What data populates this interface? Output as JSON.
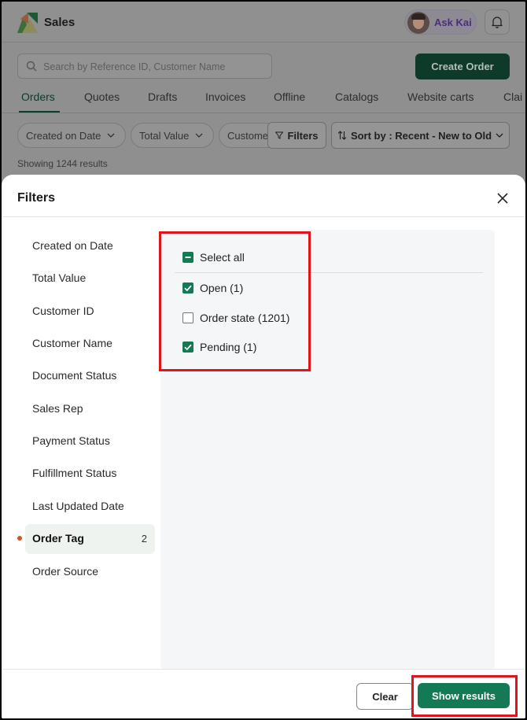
{
  "app": {
    "title": "Sales",
    "ask_label": "Ask Kai"
  },
  "search": {
    "placeholder": "Search by Reference ID, Customer Name"
  },
  "create_order_label": "Create Order",
  "tabs": [
    "Orders",
    "Quotes",
    "Drafts",
    "Invoices",
    "Offline",
    "Catalogs",
    "Website carts",
    "Clai"
  ],
  "chips": [
    "Created on Date",
    "Total Value",
    "Custome"
  ],
  "filters_label": "Filters",
  "sort_label": "Sort by : Recent - New to Old",
  "results_text": "Showing 1244 results",
  "sheet": {
    "title": "Filters",
    "nav": [
      {
        "label": "Created on Date"
      },
      {
        "label": "Total Value"
      },
      {
        "label": "Customer ID"
      },
      {
        "label": "Customer Name"
      },
      {
        "label": "Document Status"
      },
      {
        "label": "Sales Rep"
      },
      {
        "label": "Payment Status"
      },
      {
        "label": "Fulfillment Status"
      },
      {
        "label": "Last Updated Date"
      },
      {
        "label": "Order Tag",
        "count": "2",
        "active": true
      },
      {
        "label": "Order Source"
      }
    ],
    "select_all_label": "Select all",
    "options": [
      {
        "label": "Open (1)",
        "checked": true
      },
      {
        "label": "Order state (1201)",
        "checked": false
      },
      {
        "label": "Pending (1)",
        "checked": true
      }
    ],
    "clear_label": "Clear",
    "show_results_label": "Show results"
  },
  "colors": {
    "accent": "#137a55",
    "highlight": "#e0141c",
    "active_dot": "#d4551f"
  }
}
